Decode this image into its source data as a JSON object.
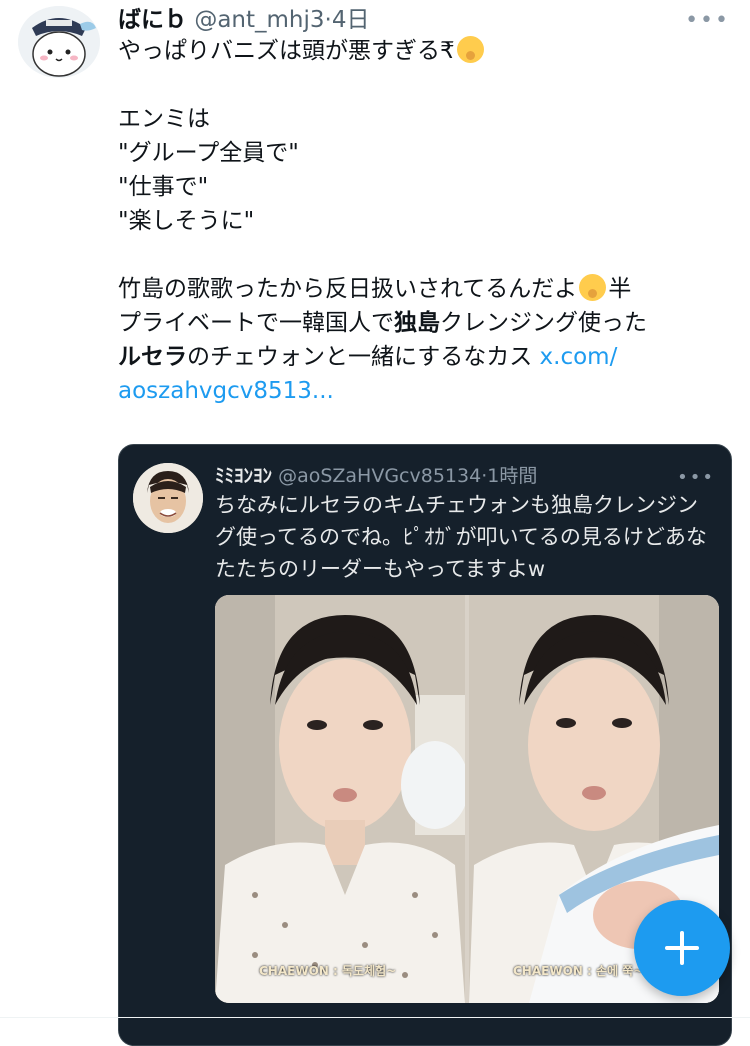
{
  "tweet": {
    "name": "ばにｂ",
    "handle": "@ant_mhj3",
    "dot": "·",
    "time": "4日",
    "more": "•••",
    "lines": {
      "l1a": "やっぱりバニズは頭が悪すぎる",
      "l1b": "₹",
      "l2": "エンミは",
      "l3": "\"グループ全員で\"",
      "l4": "\"仕事で\"",
      "l5": "\"楽しそうに\"",
      "l6a": "竹島の歌歌ったから反日扱いされてるんだよ",
      "l6b": "半",
      "l7a": "プライベートで一韓国人で",
      "l7b": "独島",
      "l7c": "クレンジング使った",
      "l8a": "ルセラ",
      "l8b": "のチェウォンと一緒にするなカス",
      "link1": "x.com/",
      "link2": "aoszahvgcv8513..."
    }
  },
  "quote": {
    "name": "ﾐﾐﾖﾝﾖﾝ",
    "handle": "@aoSZaHVGcv85134",
    "dot": "·",
    "time": "1時間",
    "more": "•••",
    "text": "ちなみにルセラのキムチェウォンも独島クレンジング使ってるのでね。ﾋﾟｵｶﾞが叩いてるの見るけどあなたたちのリーダーもやってますよw",
    "caption_left": "CHAEWON : 독도체험~",
    "caption_right": "CHAEWON : 손에 쭉~"
  },
  "icons": {
    "compose": "plus-icon",
    "emoji": "hand-over-mouth-emoji",
    "avatar": "white-character-avatar"
  },
  "colors": {
    "link": "#1d9bf0",
    "quote_bg": "#15202b",
    "fab": "#1d9bf0"
  }
}
